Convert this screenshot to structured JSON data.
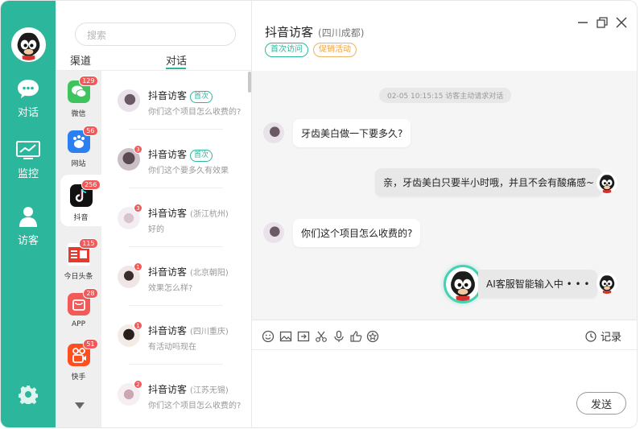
{
  "nav": {
    "items": [
      {
        "label": "对话",
        "icon": "chat-bubble-icon"
      },
      {
        "label": "监控",
        "icon": "monitor-chart-icon"
      },
      {
        "label": "访客",
        "icon": "visitor-person-icon"
      }
    ],
    "settings_icon": "gear-icon"
  },
  "search": {
    "placeholder": "搜索"
  },
  "tabs": [
    {
      "label": "渠道"
    },
    {
      "label": "对话"
    }
  ],
  "channels": [
    {
      "label": "微信",
      "badge": "129",
      "color": "#3fc35e"
    },
    {
      "label": "网站",
      "badge": "56",
      "color": "#2b7ff0"
    },
    {
      "label": "抖音",
      "badge": "256",
      "color": "#111111"
    },
    {
      "label": "今日头条",
      "badge": "115",
      "color": "#e63a2e"
    },
    {
      "label": "APP",
      "badge": "28",
      "color": "#f25a5a"
    },
    {
      "label": "快手",
      "badge": "51",
      "color": "#ff4f20"
    }
  ],
  "conversations": [
    {
      "name": "抖音访客",
      "tag": "首次",
      "location": "",
      "badge": "",
      "message": "你们这个项目怎么收费的?"
    },
    {
      "name": "抖音访客",
      "tag": "首次",
      "location": "",
      "badge": "3",
      "message": "你们这个要多久有效果"
    },
    {
      "name": "抖音访客",
      "tag": "",
      "location": "(浙江杭州)",
      "badge": "3",
      "message": "好的"
    },
    {
      "name": "抖音访客",
      "tag": "",
      "location": "(北京朝阳)",
      "badge": "1",
      "message": "效果怎么样?"
    },
    {
      "name": "抖音访客",
      "tag": "",
      "location": "(四川重庆)",
      "badge": "1",
      "message": "有活动吗现在"
    },
    {
      "name": "抖音访客",
      "tag": "",
      "location": "(江苏无锡)",
      "badge": "2",
      "message": "你们这个项目怎么收费的?"
    }
  ],
  "chat": {
    "title": "抖音访客",
    "location": "(四川成都)",
    "tags": [
      "首次访问",
      "促销活动"
    ],
    "system_note": "02-05 10:15:15 访客主动请求对话",
    "messages": [
      {
        "from": "visitor",
        "text": "牙齿美白做一下要多久?"
      },
      {
        "from": "agent",
        "text": "亲，牙齿美白只要半小时哦，并且不会有酸痛感~"
      },
      {
        "from": "visitor",
        "text": "你们这个项目怎么收费的?"
      },
      {
        "from": "ai",
        "text": "AI客服智能输入中 • • •"
      }
    ]
  },
  "toolbar": {
    "tools": [
      "emoji-icon",
      "image-icon",
      "file-icon",
      "scissors-icon",
      "microphone-icon",
      "thumbs-up-icon",
      "satisfaction-icon"
    ],
    "record_label": "记录"
  },
  "send_label": "发送",
  "colors": {
    "accent": "#2cb79c",
    "badge": "#f25a5a",
    "tag_orange": "#f0a040"
  }
}
